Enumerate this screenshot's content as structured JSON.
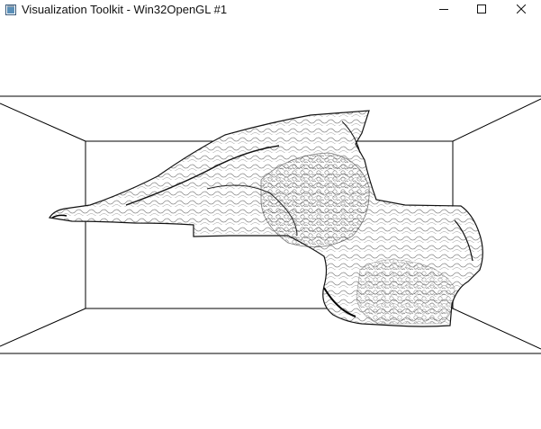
{
  "window": {
    "title": "Visualization Toolkit - Win32OpenGL #1"
  },
  "titlebar_buttons": {
    "minimize_icon": "minimize-icon",
    "maximize_icon": "maximize-icon",
    "close_icon": "close-icon"
  },
  "scene": {
    "background": "#ffffff",
    "line_color": "#000000",
    "model_fill": "#ffffff",
    "model_shade": "#2a2a2a"
  }
}
